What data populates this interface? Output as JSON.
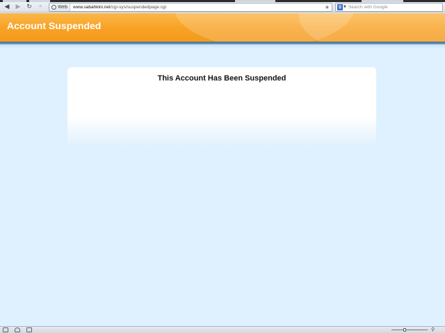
{
  "browser": {
    "identity_label": "Web",
    "url_domain": "www.sabahkini.net",
    "url_path": "/cgi-sys/suspendedpage.cgi",
    "search_placeholder": "Search with Google",
    "icons": {
      "back": "back-arrow-icon",
      "forward": "forward-arrow-icon",
      "reload": "reload-icon",
      "key": "key-icon",
      "globe": "globe-icon",
      "bookmark": "star-icon",
      "search_engine": "google-icon",
      "dropdown": "chevron-down-icon"
    },
    "statusbar_icons": [
      "sidebar-icon",
      "cloud-icon",
      "camera-icon",
      "zoom-icon"
    ]
  },
  "header": {
    "title": "Account Suspended",
    "accent_color": "#f8a125"
  },
  "panel": {
    "heading": "This Account Has Been Suspended"
  }
}
